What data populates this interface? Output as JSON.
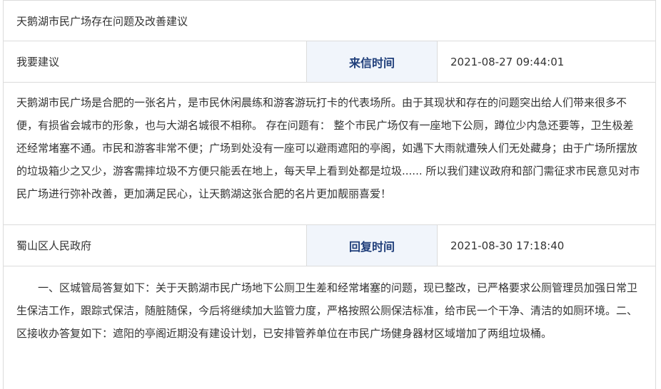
{
  "title": "天鹅湖市民广场存在问题及改善建议",
  "letter": {
    "category": "我要建议",
    "time_label": "来信时间",
    "time_value": "2021-08-27 09:44:01",
    "content": "天鹅湖市民广场是合肥的一张名片，是市民休闲晨练和游客游玩打卡的代表场所。由于其现状和存在的问题突出给人们带来很多不便，有损省会城市的形象，也与大湖名城很不相称。 存在问题有： 整个市民广场仅有一座地下公厕，蹲位少内急还要等，卫生极差还经常堵塞不通。市民和游客非常不便；广场到处没有一座可以避雨遮阳的亭阁，如遇下大雨就遭殃人们无处藏身；由于广场所摆放的垃圾箱少之又少，游客需摔垃圾不方便只能丢在地上，每天早上看到处都是垃圾...... 所以我们建议政府和部门需征求市民意见对市民广场进行弥补改善，更加满足民心，让天鹅湖这张合肥的名片更加靓丽喜爱！"
  },
  "reply": {
    "department": "蜀山区人民政府",
    "time_label": "回复时间",
    "time_value": "2021-08-30 17:18:40",
    "content": "一、区城管局答复如下：关于天鹅湖市民广场地下公厕卫生差和经常堵塞的问题，现已整改，已严格要求公厕管理员加强日常卫生保洁工作，跟踪式保洁，随脏随保，今后将继续加大监管力度，严格按照公厕保洁标准，给市民一个干净、清洁的如厕环境。二、区接收办答复如下：遮阳的亭阁近期没有建设计划，已安排管养单位在市民广场健身器材区域增加了两组垃圾桶。"
  }
}
